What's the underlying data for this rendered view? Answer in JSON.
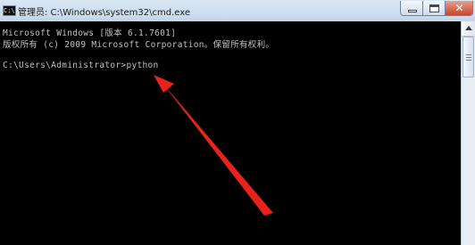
{
  "window": {
    "title": "管理员: C:\\Windows\\system32\\cmd.exe",
    "icon": "C:\\",
    "controls": {
      "minimize": "minimize-icon",
      "maximize": "maximize-icon",
      "close_label": "✕"
    }
  },
  "console": {
    "lines": [
      "Microsoft Windows [版本 6.1.7601]",
      "版权所有 (c) 2009 Microsoft Corporation。保留所有权利。",
      "",
      "C:\\Users\\Administrator>python"
    ]
  },
  "annotation": {
    "arrow_color": "#e8231c"
  },
  "colors": {
    "console_bg": "#000000",
    "console_fg": "#c0c0c0",
    "titlebar": "#c9ddef",
    "close_button": "#c8452d"
  }
}
